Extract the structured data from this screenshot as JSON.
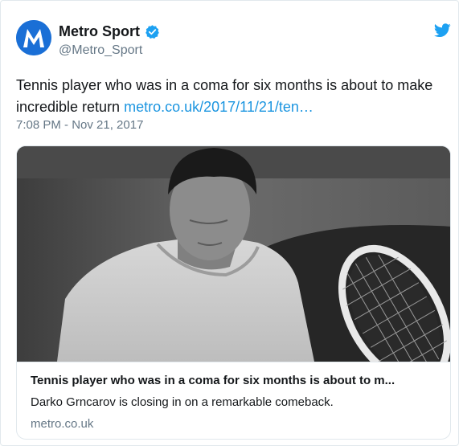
{
  "account": {
    "display_name": "Metro Sport",
    "handle": "@Metro_Sport",
    "verified": true,
    "avatar_icon": "metro-logo-icon",
    "brand_color": "#1a6fd6"
  },
  "tweet": {
    "text": "Tennis player who was in a coma for six months is about to make incredible return ",
    "link_text": "metro.co.uk/2017/11/21/ten…",
    "timestamp": "7:08 PM - Nov 21, 2017"
  },
  "card": {
    "image_icon": "tennis-player-photo",
    "title": "Tennis player who was in a coma for six months is about to m...",
    "description": "Darko Grncarov is closing in on a remarkable comeback.",
    "domain": "metro.co.uk"
  },
  "colors": {
    "link": "#1b95e0",
    "verified_badge": "#1da1f2",
    "secondary_text": "#657786",
    "bird": "#1da1f2"
  },
  "icons": {
    "verified": "verified-badge-icon",
    "twitter": "twitter-bird-icon"
  }
}
